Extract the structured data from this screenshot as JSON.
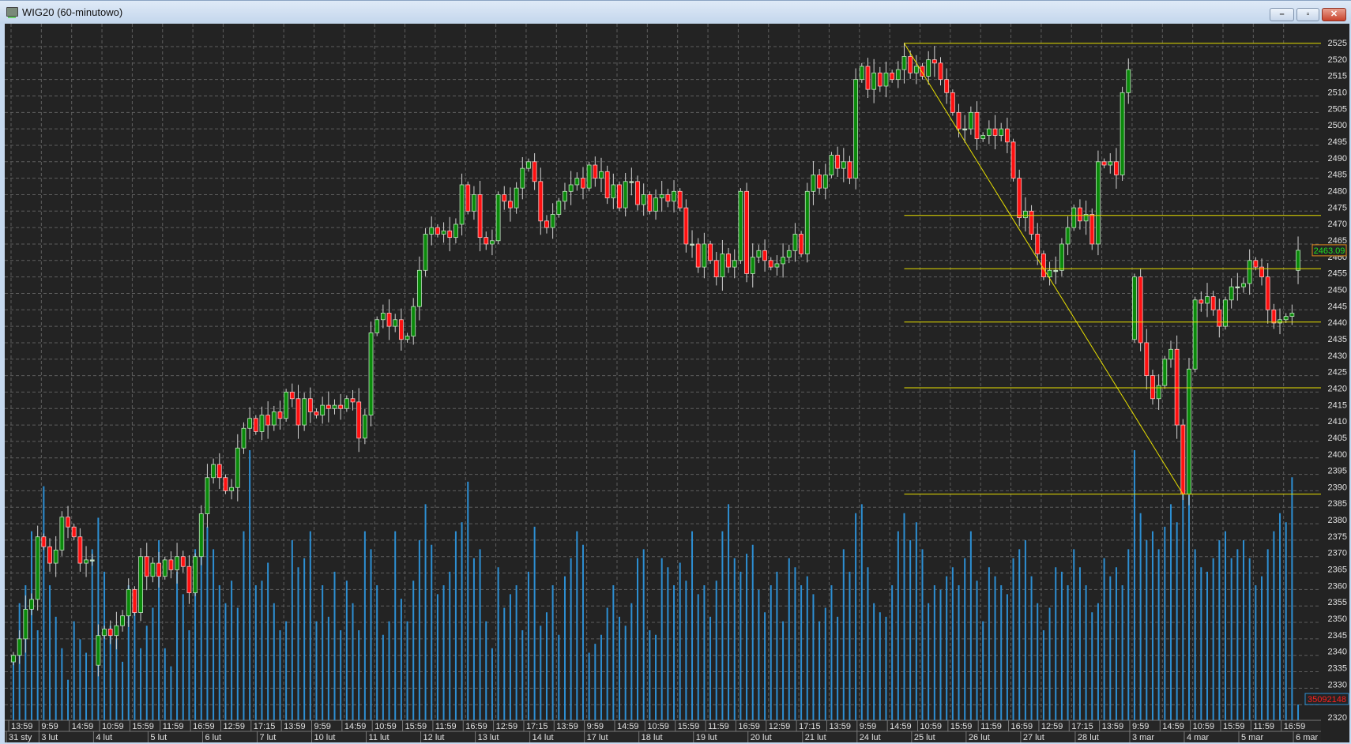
{
  "window": {
    "title": "WIG20 (60-minutowo)",
    "minimize_glyph": "–",
    "maximize_glyph": "▫",
    "close_glyph": "✕",
    "icon": "chart-window-icon"
  },
  "chart_data": {
    "type": "candlestick",
    "title": "WIG20 (60-minutowo)",
    "ylim": [
      2318,
      2528
    ],
    "y_ticks": [
      "2525",
      "2520",
      "2515",
      "2510",
      "2505",
      "2500",
      "2495",
      "2490",
      "2485",
      "2480",
      "2475",
      "2470",
      "2465",
      "2460",
      "2455",
      "2450",
      "2445",
      "2440",
      "2435",
      "2430",
      "2425",
      "2420",
      "2415",
      "2410",
      "2405",
      "2400",
      "2395",
      "2390",
      "2385",
      "2380",
      "2375",
      "2370",
      "2365",
      "2360",
      "2355",
      "2350",
      "2345",
      "2340",
      "2335",
      "2330",
      "2325",
      "2320"
    ],
    "y_tick_values": [
      2525,
      2520,
      2515,
      2510,
      2505,
      2500,
      2495,
      2490,
      2485,
      2480,
      2475,
      2470,
      2465,
      2460,
      2455,
      2450,
      2445,
      2440,
      2435,
      2430,
      2425,
      2420,
      2415,
      2410,
      2405,
      2400,
      2395,
      2390,
      2385,
      2380,
      2375,
      2370,
      2365,
      2360,
      2355,
      2350,
      2345,
      2340,
      2335,
      2330,
      2325,
      2320
    ],
    "grid": true,
    "time_labels": [
      "13:59",
      "9:59",
      "14:59",
      "10:59",
      "15:59",
      "11:59",
      "16:59",
      "12:59",
      "17:15",
      "13:59",
      "9:59",
      "14:59",
      "10:59",
      "15:59",
      "11:59",
      "16:59",
      "12:59",
      "17:15",
      "13:59",
      "9:59",
      "14:59",
      "10:59",
      "15:59",
      "11:59",
      "16:59",
      "12:59",
      "17:15",
      "13:59",
      "9:59",
      "14:59",
      "10:59",
      "15:59",
      "11:59",
      "16:59",
      "12:59",
      "17:15",
      "13:59",
      "9:59",
      "14:59",
      "10:59",
      "15:59",
      "11:59",
      "16:59"
    ],
    "days": [
      {
        "date": "31 sty",
        "open": 2338,
        "closes": [
          2340,
          2345,
          2354,
          2357,
          2376
        ],
        "volumes": [
          140,
          260,
          300,
          420,
          200
        ]
      },
      {
        "date": "3 lut",
        "closes": [
          2373,
          2368,
          2372,
          2382,
          2379,
          2376,
          2368,
          2369,
          2369
        ],
        "volumes": [
          520,
          300,
          230,
          160,
          90,
          220,
          180,
          150,
          380
        ]
      },
      {
        "date": "4 lut",
        "open": 2337,
        "closes": [
          2346,
          2348,
          2346,
          2349,
          2352,
          2360,
          2353,
          2370,
          2364
        ],
        "volumes": [
          450,
          330,
          210,
          180,
          130,
          300,
          280,
          160,
          210
        ]
      },
      {
        "date": "5 lut",
        "closes": [
          2368,
          2364,
          2369,
          2366,
          2370,
          2367,
          2359,
          2370,
          2383
        ],
        "volumes": [
          250,
          400,
          160,
          120,
          330,
          280,
          200,
          380,
          440
        ]
      },
      {
        "date": "6 lut",
        "closes": [
          2394,
          2398,
          2394,
          2390,
          2391,
          2403,
          2409,
          2412,
          2408
        ],
        "volumes": [
          430,
          380,
          300,
          260,
          310,
          250,
          420,
          600,
          300
        ]
      },
      {
        "date": "7 lut",
        "closes": [
          2413,
          2410,
          2414,
          2412,
          2420,
          2418,
          2410,
          2418,
          2414
        ],
        "volumes": [
          310,
          350,
          260,
          200,
          220,
          400,
          340,
          360,
          420
        ]
      },
      {
        "date": "10 lut",
        "closes": [
          2413,
          2416,
          2415,
          2416,
          2415,
          2418,
          2417,
          2406,
          2413
        ],
        "volumes": [
          220,
          300,
          230,
          330,
          200,
          310,
          260,
          200,
          420
        ]
      },
      {
        "date": "11 lut",
        "closes": [
          2438,
          2442,
          2444,
          2440,
          2442,
          2436,
          2437,
          2446,
          2457
        ],
        "volumes": [
          380,
          300,
          190,
          220,
          420,
          270,
          220,
          310,
          400
        ]
      },
      {
        "date": "12 lut",
        "closes": [
          2468,
          2470,
          2468,
          2469,
          2467,
          2471,
          2483,
          2475,
          2480
        ],
        "volumes": [
          480,
          390,
          280,
          300,
          330,
          420,
          440,
          530,
          360
        ]
      },
      {
        "date": "13 lut",
        "closes": [
          2467,
          2465,
          2466,
          2480,
          2478,
          2476,
          2482,
          2488,
          2490
        ],
        "volumes": [
          380,
          220,
          160,
          340,
          250,
          280,
          300,
          200,
          330
        ]
      },
      {
        "date": "14 lut",
        "closes": [
          2484,
          2472,
          2470,
          2474,
          2478,
          2481,
          2483,
          2485,
          2482
        ],
        "volumes": [
          430,
          210,
          240,
          300,
          190,
          320,
          360,
          420,
          390
        ]
      },
      {
        "date": "17 lut",
        "closes": [
          2489,
          2485,
          2487,
          2479,
          2483,
          2476,
          2484,
          2484,
          2477
        ],
        "volumes": [
          150,
          170,
          190,
          250,
          300,
          230,
          210,
          260,
          360
        ]
      },
      {
        "date": "18 lut",
        "closes": [
          2480,
          2475,
          2479,
          2480,
          2478,
          2481,
          2476,
          2465,
          2465
        ],
        "volumes": [
          380,
          200,
          190,
          360,
          340,
          300,
          350,
          310,
          420
        ]
      },
      {
        "date": "19 lut",
        "closes": [
          2458,
          2465,
          2460,
          2455,
          2462,
          2458,
          2460,
          2481,
          2456
        ],
        "volumes": [
          280,
          300,
          230,
          310,
          420,
          480,
          360,
          330,
          370
        ]
      },
      {
        "date": "20 lut",
        "closes": [
          2461,
          2463,
          2460,
          2458,
          2459,
          2461,
          2463,
          2468,
          2462
        ],
        "volumes": [
          390,
          290,
          240,
          300,
          330,
          220,
          360,
          340,
          300
        ]
      },
      {
        "date": "21 lut",
        "closes": [
          2481,
          2486,
          2482,
          2486,
          2492,
          2488,
          2490,
          2485,
          2515
        ],
        "volumes": [
          320,
          280,
          220,
          250,
          300,
          230,
          380,
          330,
          460
        ]
      },
      {
        "date": "24 lut",
        "closes": [
          2519,
          2512,
          2517,
          2513,
          2517,
          2515,
          2518,
          2522,
          2517
        ],
        "volumes": [
          480,
          340,
          260,
          240,
          230,
          300,
          420,
          460,
          400
        ]
      },
      {
        "date": "25 lut",
        "closes": [
          2519,
          2516,
          2521,
          2520,
          2515,
          2511,
          2505,
          2500,
          2500
        ],
        "volumes": [
          440,
          380,
          260,
          300,
          290,
          320,
          340,
          300,
          360
        ]
      },
      {
        "date": "26 lut",
        "closes": [
          2505,
          2497,
          2498,
          2500,
          2498,
          2500,
          2496,
          2485,
          2473
        ],
        "volumes": [
          420,
          310,
          220,
          340,
          320,
          300,
          280,
          360,
          380
        ]
      },
      {
        "date": "27 lut",
        "closes": [
          2475,
          2468,
          2462,
          2455,
          2457,
          2457,
          2465,
          2470,
          2476
        ],
        "volumes": [
          400,
          320,
          260,
          200,
          250,
          340,
          330,
          300,
          380
        ]
      },
      {
        "date": "28 lut",
        "closes": [
          2472,
          2474,
          2465,
          2490,
          2489,
          2490,
          2486,
          2511,
          2518
        ],
        "volumes": [
          340,
          300,
          240,
          260,
          360,
          320,
          340,
          300,
          380
        ]
      },
      {
        "date": "3 mar",
        "open": 2436,
        "closes": [
          2455,
          2435,
          2425,
          2418,
          2422,
          2430,
          2433,
          2410,
          2389
        ],
        "volumes": [
          600,
          460,
          400,
          420,
          380,
          430,
          480,
          440,
          600
        ]
      },
      {
        "date": "4 mar",
        "closes": [
          2427,
          2448,
          2447,
          2449,
          2445,
          2440,
          2448,
          2452,
          2452
        ],
        "volumes": [
          500,
          380,
          340,
          330,
          360,
          400,
          420,
          360,
          380
        ]
      },
      {
        "date": "5 mar",
        "closes": [
          2453,
          2460,
          2458,
          2455,
          2445,
          2441,
          2442,
          2443,
          2444
        ],
        "volumes": [
          400,
          360,
          300,
          320,
          380,
          420,
          460,
          440,
          540
        ]
      },
      {
        "date": "6 mar",
        "open": 2457,
        "closes": [
          2463.09
        ],
        "volumes": [
          35.09
        ]
      }
    ],
    "volume_unit": "millions",
    "last_price": "2463.09",
    "last_volume": "35092148",
    "fibonacci": {
      "high": 2526,
      "low": 2389,
      "levels": [
        2526,
        2473.7,
        2457.5,
        2441.3,
        2421.3,
        2389
      ],
      "start_candle": 147,
      "end_candle": 193
    },
    "colors": {
      "background": "#232323",
      "grid": "#5e5e5e",
      "up": "#0a8a0a",
      "down": "#ff1010",
      "wick": "#d0d0d0",
      "volume": "#2d8fd3",
      "fib": "#e8e000",
      "axis_text": "#e0e0e0",
      "last_price_text": "#20e020",
      "last_price_border": "#e08a1a",
      "last_volume_text": "#ff2020",
      "last_volume_border": "#2d8fd3"
    }
  }
}
